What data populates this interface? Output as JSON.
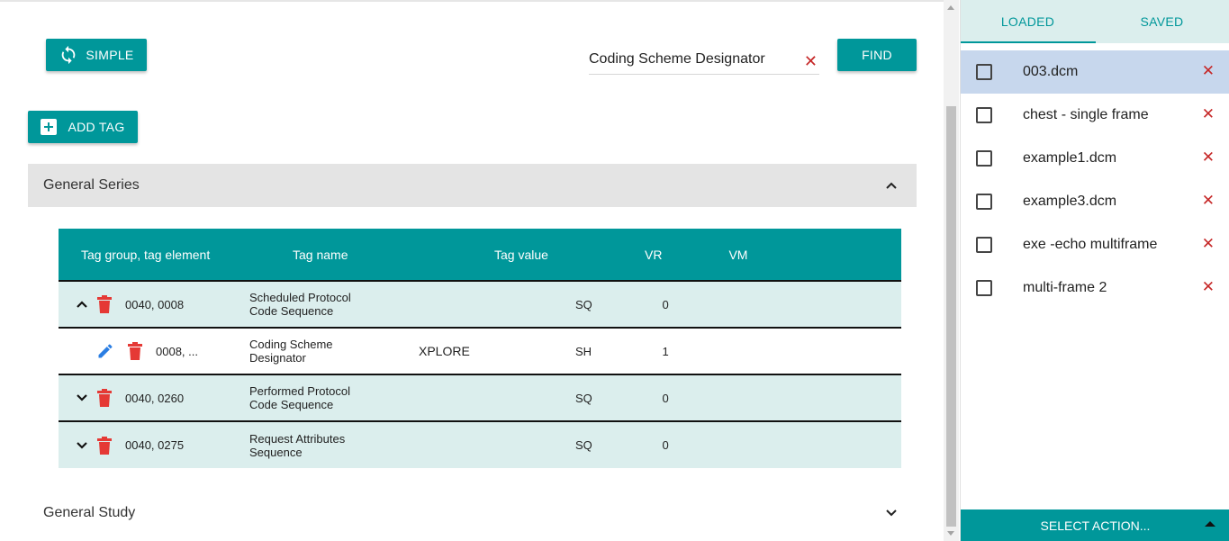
{
  "toolbar": {
    "simple_label": "SIMPLE",
    "find_label": "FIND",
    "add_tag_label": "ADD TAG"
  },
  "search": {
    "value": "Coding Scheme Designator",
    "clear_glyph": "✕"
  },
  "sections": {
    "series_title": "General Series",
    "study_title": "General Study"
  },
  "table": {
    "headers": {
      "group": "Tag group, tag element",
      "name": "Tag name",
      "value": "Tag value",
      "vr": "VR",
      "vm": "VM"
    },
    "rows": [
      {
        "tag": "0040, 0008",
        "name1": "Scheduled Protocol",
        "name2": "Code Sequence",
        "value": "",
        "vr": "SQ",
        "vm": "0"
      },
      {
        "tag": "0008, ...",
        "name1": "Coding Scheme",
        "name2": "Designator",
        "value": "XPLORE",
        "vr": "SH",
        "vm": "1"
      },
      {
        "tag": "0040, 0260",
        "name1": "Performed Protocol",
        "name2": "Code Sequence",
        "value": "",
        "vr": "SQ",
        "vm": "0"
      },
      {
        "tag": "0040, 0275",
        "name1": "Request Attributes",
        "name2": "Sequence",
        "value": "",
        "vr": "SQ",
        "vm": "0"
      }
    ]
  },
  "side": {
    "tabs": {
      "loaded": "LOADED",
      "saved": "SAVED"
    },
    "files": [
      {
        "name": "003.dcm"
      },
      {
        "name": "chest - single frame"
      },
      {
        "name": "example1.dcm"
      },
      {
        "name": "example3.dcm"
      },
      {
        "name": "exe -echo multiframe"
      },
      {
        "name": "multi-frame 2"
      }
    ],
    "delete_glyph": "✕",
    "action_label": "SELECT ACTION..."
  },
  "colors": {
    "accent": "#00979a",
    "accent_light": "#dbeeed",
    "selected": "#c7d7ed",
    "delete": "#e53935",
    "edit": "#2a7ee3"
  }
}
